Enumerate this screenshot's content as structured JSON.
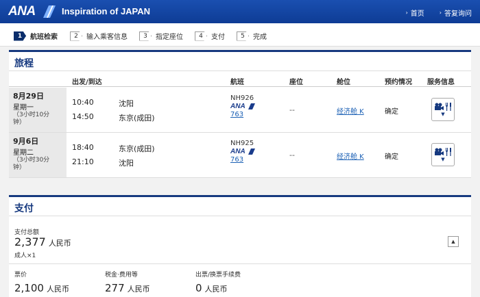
{
  "header": {
    "logo_text": "ANA",
    "tagline": "Inspiration of JAPAN",
    "links": [
      "首页",
      "答复询问"
    ]
  },
  "steps": [
    {
      "num": "1",
      "label": "航班检索",
      "active": true
    },
    {
      "num": "2",
      "label": "输入乘客信息",
      "active": false
    },
    {
      "num": "3",
      "label": "指定座位",
      "active": false
    },
    {
      "num": "4",
      "label": "支付",
      "active": false
    },
    {
      "num": "5",
      "label": "完成",
      "active": false
    }
  ],
  "itinerary": {
    "title": "旅程",
    "columns": {
      "depart_arrive": "出发/到达",
      "flight": "航班",
      "seat": "座位",
      "cabin": "舱位",
      "booking_status": "预约情况",
      "service": "服务信息"
    },
    "segments": [
      {
        "date": "8月29日",
        "weekday": "星期一",
        "duration_1": "（3小时10分",
        "duration_2": "钟）",
        "dep_time": "10:40",
        "dep_city": "沈阳",
        "arr_time": "14:50",
        "arr_city": "东京(成田)",
        "flight_no": "NH926",
        "airline": "ANA",
        "aircraft": "763",
        "seat": "--",
        "cabin": "经济舱 K",
        "status": "确定"
      },
      {
        "date": "9月6日",
        "weekday": "星期二",
        "duration_1": "（3小时30分",
        "duration_2": "钟）",
        "dep_time": "18:40",
        "dep_city": "东京(成田)",
        "arr_time": "21:10",
        "arr_city": "沈阳",
        "flight_no": "NH925",
        "airline": "ANA",
        "aircraft": "763",
        "seat": "--",
        "cabin": "经济舱 K",
        "status": "确定"
      }
    ]
  },
  "payment": {
    "title": "支付",
    "total_label": "支付总额",
    "total_value": "2,377",
    "currency": "人民币",
    "passengers": "成人×1",
    "fees": [
      {
        "label": "票价",
        "value": "2,100",
        "currency": "人民币"
      },
      {
        "label": "税金·费用等",
        "value": "277",
        "currency": "人民币"
      },
      {
        "label": "出票/换票手续费",
        "value": "0",
        "currency": "人民币"
      }
    ]
  },
  "icons": {
    "service_icons": [
      "movie-camera-icon",
      "meal-icon"
    ],
    "colors": {
      "brand_blue": "#16397f",
      "link_blue": "#1a5fb4"
    }
  }
}
